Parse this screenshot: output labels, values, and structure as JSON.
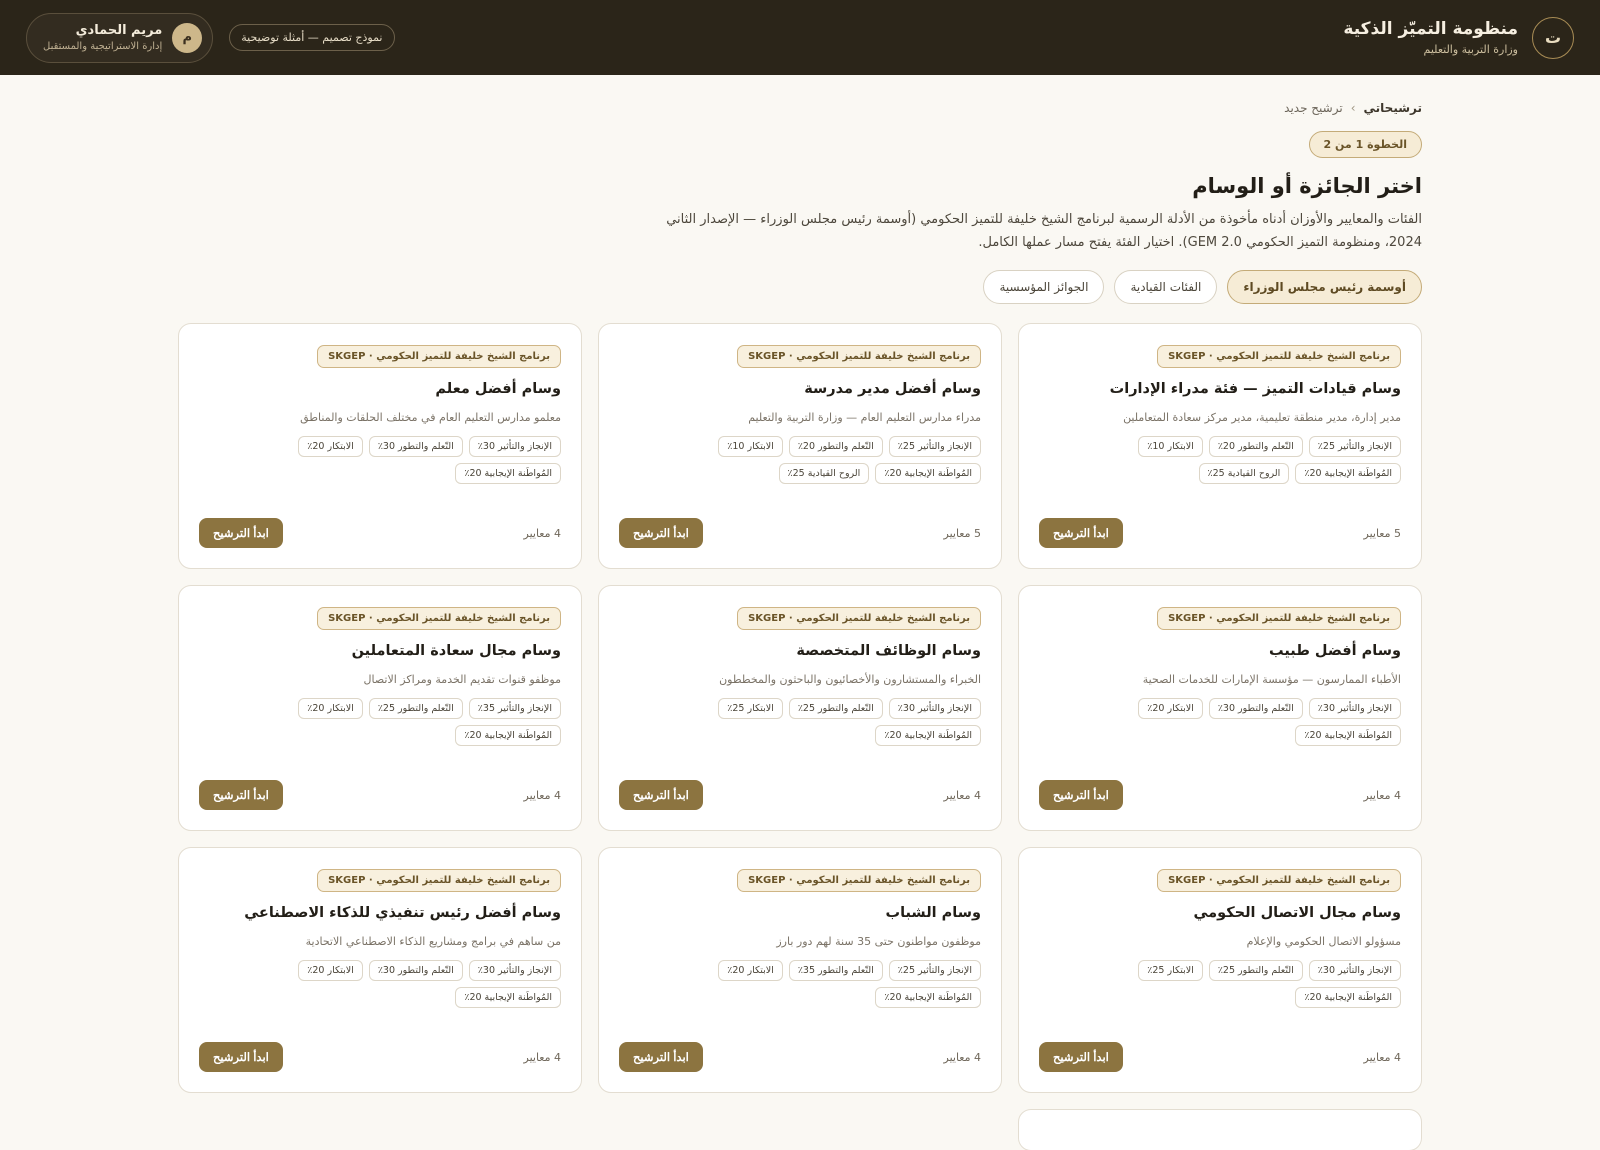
{
  "header": {
    "logo_letter": "ت",
    "title": "منظومة التميّز الذكية",
    "subtitle": "وزارة التربية والتعليم",
    "sample_label": "نموذج تصميم — أمثلة توضيحية",
    "user": {
      "initial": "م",
      "name": "مريم الحمادي",
      "department": "إدارة الاستراتيجية والمستقبل"
    }
  },
  "breadcrumb": {
    "root": "ترشيحاتي",
    "separator": "›",
    "current": "ترشيح جديد"
  },
  "step_badge": "الخطوة 1 من 2",
  "page_title": "اختر الجائزة أو الوسام",
  "page_description": "الفئات والمعايير والأوزان أدناه مأخوذة من الأدلة الرسمية لبرنامج الشيخ خليفة للتميز الحكومي (أوسمة رئيس مجلس الوزراء — الإصدار الثاني 2024، ومنظومة التميز الحكومي GEM 2.0). اختيار الفئة يفتح مسار عملها الكامل.",
  "tabs": [
    {
      "label": "أوسمة رئيس مجلس الوزراء",
      "active": true
    },
    {
      "label": "الفئات القيادية",
      "active": false
    },
    {
      "label": "الجوائز المؤسسية",
      "active": false
    }
  ],
  "cards": [
    {
      "badge": "برنامج الشيخ خليفة للتميز الحكومي · SKGEP",
      "title": "وسام قيادات التميز — فئة مدراء الإدارات",
      "description": "مدير إدارة، مدير منطقة تعليمية، مدير مركز سعادة المتعاملين",
      "chips": [
        "الإنجاز والتأثير 25٪",
        "التّعلم والتطور 20٪",
        "الابتكار 10٪",
        "المُواطَنة الإيجابية 20٪",
        "الروح القيادية 25٪"
      ],
      "count": "5 معايير",
      "button": "ابدأ الترشيح"
    },
    {
      "badge": "برنامج الشيخ خليفة للتميز الحكومي · SKGEP",
      "title": "وسام أفضل مدير مدرسة",
      "description": "مدراء مدارس التعليم العام — وزارة التربية والتعليم",
      "chips": [
        "الإنجاز والتأثير 25٪",
        "التّعلم والتطور 20٪",
        "الابتكار 10٪",
        "المُواطَنة الإيجابية 20٪",
        "الروح القيادية 25٪"
      ],
      "count": "5 معايير",
      "button": "ابدأ الترشيح"
    },
    {
      "badge": "برنامج الشيخ خليفة للتميز الحكومي · SKGEP",
      "title": "وسام أفضل معلم",
      "description": "معلمو مدارس التعليم العام في مختلف الحلقات والمناطق",
      "chips": [
        "الإنجاز والتأثير 30٪",
        "التّعلم والتطور 30٪",
        "الابتكار 20٪",
        "المُواطَنة الإيجابية 20٪"
      ],
      "count": "4 معايير",
      "button": "ابدأ الترشيح"
    },
    {
      "badge": "برنامج الشيخ خليفة للتميز الحكومي · SKGEP",
      "title": "وسام أفضل طبيب",
      "description": "الأطباء الممارسون — مؤسسة الإمارات للخدمات الصحية",
      "chips": [
        "الإنجاز والتأثير 30٪",
        "التّعلم والتطور 30٪",
        "الابتكار 20٪",
        "المُواطَنة الإيجابية 20٪"
      ],
      "count": "4 معايير",
      "button": "ابدأ الترشيح"
    },
    {
      "badge": "برنامج الشيخ خليفة للتميز الحكومي · SKGEP",
      "title": "وسام الوظائف المتخصصة",
      "description": "الخبراء والمستشارون والأخصائيون والباحثون والمخططون",
      "chips": [
        "الإنجاز والتأثير 30٪",
        "التّعلم والتطور 25٪",
        "الابتكار 25٪",
        "المُواطَنة الإيجابية 20٪"
      ],
      "count": "4 معايير",
      "button": "ابدأ الترشيح"
    },
    {
      "badge": "برنامج الشيخ خليفة للتميز الحكومي · SKGEP",
      "title": "وسام مجال سعادة المتعاملين",
      "description": "موظفو قنوات تقديم الخدمة ومراكز الاتصال",
      "chips": [
        "الإنجاز والتأثير 35٪",
        "التّعلم والتطور 25٪",
        "الابتكار 20٪",
        "المُواطَنة الإيجابية 20٪"
      ],
      "count": "4 معايير",
      "button": "ابدأ الترشيح"
    },
    {
      "badge": "برنامج الشيخ خليفة للتميز الحكومي · SKGEP",
      "title": "وسام مجال الاتصال الحكومي",
      "description": "مسؤولو الاتصال الحكومي والإعلام",
      "chips": [
        "الإنجاز والتأثير 30٪",
        "التّعلم والتطور 25٪",
        "الابتكار 25٪",
        "المُواطَنة الإيجابية 20٪"
      ],
      "count": "4 معايير",
      "button": "ابدأ الترشيح"
    },
    {
      "badge": "برنامج الشيخ خليفة للتميز الحكومي · SKGEP",
      "title": "وسام الشباب",
      "description": "موظفون مواطنون حتى 35 سنة لهم دور بارز",
      "chips": [
        "الإنجاز والتأثير 25٪",
        "التّعلم والتطور 35٪",
        "الابتكار 20٪",
        "المُواطَنة الإيجابية 20٪"
      ],
      "count": "4 معايير",
      "button": "ابدأ الترشيح"
    },
    {
      "badge": "برنامج الشيخ خليفة للتميز الحكومي · SKGEP",
      "title": "وسام أفضل رئيس تنفيذي للذكاء الاصطناعي",
      "description": "من ساهم في برامج ومشاريع الذكاء الاصطناعي الاتحادية",
      "chips": [
        "الإنجاز والتأثير 30٪",
        "التّعلم والتطور 30٪",
        "الابتكار 20٪",
        "المُواطَنة الإيجابية 20٪"
      ],
      "count": "4 معايير",
      "button": "ابدأ الترشيح"
    }
  ]
}
